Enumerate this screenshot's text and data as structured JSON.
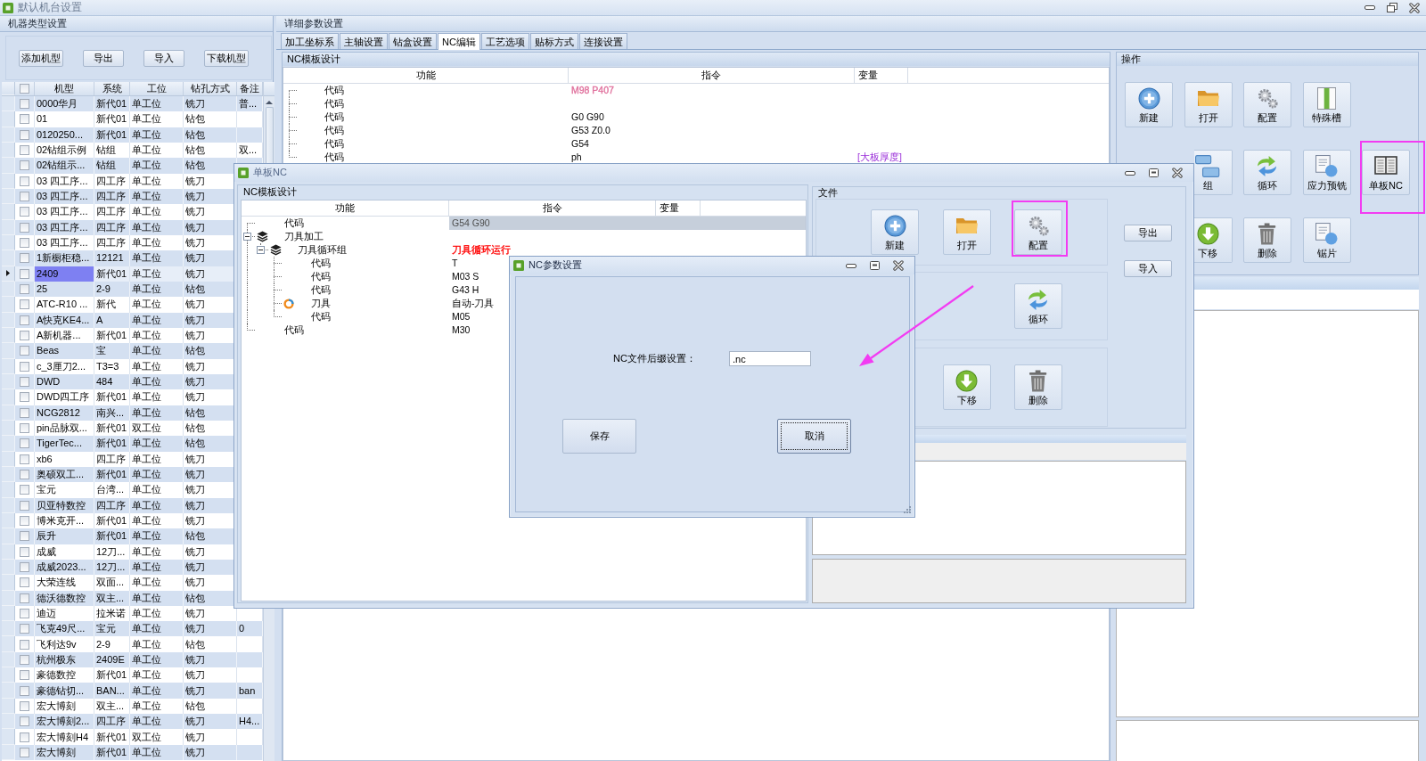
{
  "window": {
    "title": "默认机台设置"
  },
  "machine_panel": {
    "title": "机器类型设置",
    "toolbar": [
      "添加机型",
      "导出",
      "导入",
      "下载机型"
    ],
    "table": {
      "header_checked": false,
      "columns": [
        "机型",
        "系统",
        "工位",
        "钻孔方式",
        "备注"
      ],
      "rows": [
        {
          "cells": [
            "0000华月",
            "新代01",
            "单工位",
            "铣刀",
            "普..."
          ],
          "checked": false,
          "selected": false
        },
        {
          "cells": [
            "01",
            "新代01",
            "单工位",
            "钻包"
          ],
          "checked": false,
          "selected": false
        },
        {
          "cells": [
            "0120250...",
            "新代01",
            "单工位",
            "钻包"
          ],
          "checked": false,
          "selected": false
        },
        {
          "cells": [
            "02钻组示例",
            "钻组",
            "单工位",
            "钻包",
            "双..."
          ],
          "checked": false,
          "selected": false
        },
        {
          "cells": [
            "02钻组示...",
            "钻组",
            "单工位",
            "钻包"
          ],
          "checked": false,
          "selected": false
        },
        {
          "cells": [
            "03 四工序...",
            "四工序",
            "单工位",
            "铣刀"
          ],
          "checked": false,
          "selected": false
        },
        {
          "cells": [
            "03 四工序...",
            "四工序",
            "单工位",
            "铣刀"
          ],
          "checked": false,
          "selected": false
        },
        {
          "cells": [
            "03 四工序...",
            "四工序",
            "单工位",
            "铣刀"
          ],
          "checked": false,
          "selected": false
        },
        {
          "cells": [
            "03 四工序...",
            "四工序",
            "单工位",
            "铣刀"
          ],
          "checked": false,
          "selected": false
        },
        {
          "cells": [
            "03 四工序...",
            "四工序",
            "单工位",
            "铣刀"
          ],
          "checked": false,
          "selected": false
        },
        {
          "cells": [
            "1新橱柜稳...",
            "12121",
            "单工位",
            "铣刀"
          ],
          "checked": false,
          "selected": false
        },
        {
          "cells": [
            "2409",
            "新代01",
            "单工位",
            "铣刀"
          ],
          "checked": false,
          "selected": true
        },
        {
          "cells": [
            "25",
            "2-9",
            "单工位",
            "钻包"
          ],
          "checked": false,
          "selected": false
        },
        {
          "cells": [
            "ATC-R10 ...",
            "新代",
            "单工位",
            "铣刀"
          ],
          "checked": false,
          "selected": false
        },
        {
          "cells": [
            "A快克KE4...",
            "A",
            "单工位",
            "铣刀"
          ],
          "checked": false,
          "selected": false
        },
        {
          "cells": [
            "A新机器...",
            "新代01",
            "单工位",
            "铣刀"
          ],
          "checked": false,
          "selected": false
        },
        {
          "cells": [
            "Beas",
            "宝",
            "单工位",
            "钻包"
          ],
          "checked": false,
          "selected": false
        },
        {
          "cells": [
            "c_3厘刀2...",
            "T3=3",
            "单工位",
            "铣刀"
          ],
          "checked": false,
          "selected": false
        },
        {
          "cells": [
            "DWD",
            "484",
            "单工位",
            "铣刀"
          ],
          "checked": false,
          "selected": false
        },
        {
          "cells": [
            "DWD四工序",
            "新代01",
            "单工位",
            "铣刀"
          ],
          "checked": false,
          "selected": false
        },
        {
          "cells": [
            "NCG2812",
            "南兴...",
            "单工位",
            "钻包"
          ],
          "checked": false,
          "selected": false
        },
        {
          "cells": [
            "pin品脉双...",
            "新代01",
            "双工位",
            "钻包"
          ],
          "checked": false,
          "selected": false
        },
        {
          "cells": [
            "TigerTec...",
            "新代01",
            "单工位",
            "钻包"
          ],
          "checked": false,
          "selected": false
        },
        {
          "cells": [
            "xb6",
            "四工序",
            "单工位",
            "铣刀"
          ],
          "checked": false,
          "selected": false
        },
        {
          "cells": [
            "奥硕双工...",
            "新代01",
            "单工位",
            "铣刀"
          ],
          "checked": false,
          "selected": false
        },
        {
          "cells": [
            "宝元",
            "台湾...",
            "单工位",
            "铣刀"
          ],
          "checked": false,
          "selected": false
        },
        {
          "cells": [
            "贝亚特数控",
            "四工序",
            "单工位",
            "铣刀"
          ],
          "checked": false,
          "selected": false
        },
        {
          "cells": [
            "博米克开...",
            "新代01",
            "单工位",
            "铣刀"
          ],
          "checked": false,
          "selected": false
        },
        {
          "cells": [
            "辰升",
            "新代01",
            "单工位",
            "钻包"
          ],
          "checked": false,
          "selected": false
        },
        {
          "cells": [
            "成威",
            "12刀...",
            "单工位",
            "铣刀"
          ],
          "checked": false,
          "selected": false
        },
        {
          "cells": [
            "成威2023...",
            "12刀...",
            "单工位",
            "铣刀"
          ],
          "checked": false,
          "selected": false
        },
        {
          "cells": [
            "大荣连线",
            "双面...",
            "单工位",
            "铣刀"
          ],
          "checked": false,
          "selected": false
        },
        {
          "cells": [
            "德沃德数控",
            "双主...",
            "单工位",
            "钻包"
          ],
          "checked": false,
          "selected": false
        },
        {
          "cells": [
            "迪迈",
            "拉米诺",
            "单工位",
            "铣刀"
          ],
          "checked": false,
          "selected": false
        },
        {
          "cells": [
            "飞克49尺...",
            "宝元",
            "单工位",
            "铣刀",
            "0"
          ],
          "checked": false,
          "selected": false
        },
        {
          "cells": [
            "飞利达9v",
            "2-9",
            "单工位",
            "钻包"
          ],
          "checked": false,
          "selected": false
        },
        {
          "cells": [
            "杭州极东",
            "2409E",
            "单工位",
            "铣刀"
          ],
          "checked": false,
          "selected": false
        },
        {
          "cells": [
            "豪德数控",
            "新代01",
            "单工位",
            "铣刀"
          ],
          "checked": false,
          "selected": false
        },
        {
          "cells": [
            "豪德钻切...",
            "BAN...",
            "单工位",
            "铣刀",
            "ban"
          ],
          "checked": false,
          "selected": false
        },
        {
          "cells": [
            "宏大博刻",
            "双主...",
            "单工位",
            "钻包"
          ],
          "checked": false,
          "selected": false
        },
        {
          "cells": [
            "宏大博刻2...",
            "四工序",
            "单工位",
            "铣刀",
            "H4..."
          ],
          "checked": false,
          "selected": false
        },
        {
          "cells": [
            "宏大博刻H4",
            "新代01",
            "双工位",
            "铣刀"
          ],
          "checked": false,
          "selected": false
        },
        {
          "cells": [
            "宏大博刻",
            "新代01",
            "单工位",
            "铣刀"
          ],
          "checked": false,
          "selected": false
        }
      ]
    }
  },
  "detail_panel": {
    "title": "详细参数设置",
    "tabs": [
      {
        "label": "加工坐标系",
        "selected": false
      },
      {
        "label": "主轴设置",
        "selected": false
      },
      {
        "label": "钻盒设置",
        "selected": false
      },
      {
        "label": "NC编辑",
        "selected": true
      },
      {
        "label": "工艺选项",
        "selected": false
      },
      {
        "label": "贴标方式",
        "selected": false
      },
      {
        "label": "连接设置",
        "selected": false
      }
    ],
    "nc_template": {
      "title": "NC模板设计",
      "columns": [
        "功能",
        "指令",
        "变量"
      ],
      "rows": [
        {
          "kind": "code",
          "function": "代码",
          "instruction": "M98 P407",
          "color": "#e0709c"
        },
        {
          "kind": "code",
          "function": "代码"
        },
        {
          "kind": "code",
          "function": "代码",
          "instruction": "G0 G90"
        },
        {
          "kind": "code",
          "function": "代码",
          "instruction": "G53 Z0.0"
        },
        {
          "kind": "code",
          "function": "代码",
          "instruction": "G54"
        },
        {
          "kind": "code",
          "function": "代码",
          "instruction": "ph",
          "variable": "[大板厚度]"
        }
      ]
    },
    "operations": {
      "title": "操作",
      "rows": [
        [
          {
            "label": "新建",
            "highlighted": false
          },
          {
            "label": "打开",
            "highlighted": false
          },
          {
            "label": "配置",
            "highlighted": false
          },
          {
            "label": "特殊槽",
            "highlighted": false
          }
        ],
        [
          "",
          {
            "label": "组",
            "highlighted": false
          },
          {
            "label": "循环",
            "highlighted": false
          },
          {
            "label": "应力预铣",
            "highlighted": false
          },
          {
            "label": "单板NC",
            "highlighted": true
          }
        ],
        [
          "",
          {
            "label": "下移",
            "highlighted": false
          },
          {
            "label": "删除",
            "highlighted": false
          },
          {
            "label": "锯片",
            "highlighted": false
          }
        ]
      ]
    }
  },
  "board_nc_dialog": {
    "title": "单板NC",
    "template": {
      "title": "NC模板设计",
      "columns": [
        "功能",
        "指令",
        "变量"
      ],
      "tree": [
        {
          "kind": "code",
          "function": "代码",
          "instruction": "G54 G90",
          "selected": true
        },
        {
          "kind": "group",
          "function": "刀具加工",
          "expanded": true,
          "selected": false,
          "children": [
            {
              "kind": "group",
              "function": "刀具循环组",
              "instruction": "刀具循环运行",
              "color": "#ff0000",
              "expanded": true,
              "selected": false,
              "children": [
                {
                  "kind": "code",
                  "function": "代码",
                  "instruction": "T",
                  "selected": false
                },
                {
                  "kind": "code",
                  "function": "代码",
                  "instruction": "M03 S",
                  "selected": false
                },
                {
                  "kind": "code",
                  "function": "代码",
                  "instruction": "G43 H",
                  "selected": false
                },
                {
                  "kind": "tool",
                  "function": "刀具",
                  "instruction": "自动-刀具",
                  "selected": false
                },
                {
                  "kind": "code",
                  "function": "代码",
                  "instruction": "M05",
                  "selected": false
                }
              ]
            }
          ]
        },
        {
          "kind": "code",
          "function": "代码",
          "instruction": "M30",
          "selected": false
        }
      ]
    },
    "file_group": {
      "title": "文件",
      "rows": [
        [
          {
            "label": "新建",
            "highlighted": false
          },
          {
            "label": "打开",
            "highlighted": false
          },
          {
            "label": "配置",
            "highlighted": true
          }
        ],
        [
          "",
          "",
          {
            "label": "循环",
            "highlighted": false
          }
        ],
        [
          "",
          {
            "label": "下移",
            "highlighted": false
          },
          {
            "label": "删除",
            "highlighted": false
          }
        ]
      ]
    },
    "side_buttons": [
      "导出",
      "导入"
    ]
  },
  "nc_param_dialog": {
    "title": "NC参数设置",
    "suffix_label": "NC文件后缀设置：",
    "suffix_value": ".nc",
    "buttons": [
      {
        "label": "保存",
        "focused": false
      },
      {
        "label": "取消",
        "focused": true
      }
    ]
  }
}
